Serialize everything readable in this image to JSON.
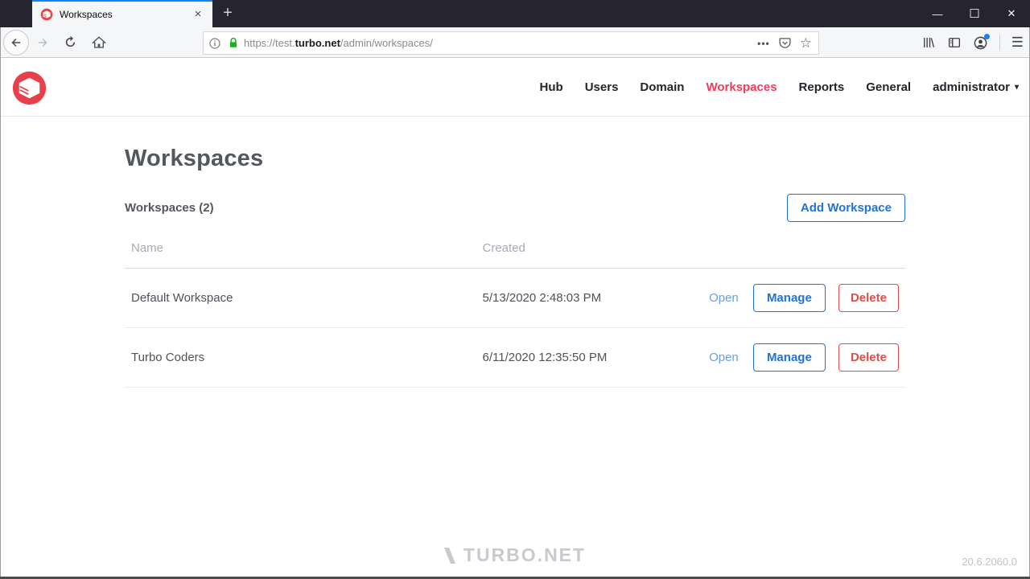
{
  "browser": {
    "tab": {
      "title": "Workspaces",
      "close_glyph": "×"
    },
    "new_tab_glyph": "+",
    "window_controls": {
      "minimize": "—",
      "maximize": "☐",
      "close": "✕"
    },
    "url": {
      "scheme_and_sub": "https://test.",
      "domain": "turbo.net",
      "path": "/admin/workspaces/"
    },
    "icons": {
      "page_actions_ellipsis": "•••",
      "bookmark_star": "☆",
      "menu_hamburger": "☰"
    }
  },
  "navbar": {
    "items": [
      {
        "label": "Hub",
        "active": false
      },
      {
        "label": "Users",
        "active": false
      },
      {
        "label": "Domain",
        "active": false
      },
      {
        "label": "Workspaces",
        "active": true
      },
      {
        "label": "Reports",
        "active": false
      },
      {
        "label": "General",
        "active": false
      }
    ],
    "user_menu": {
      "label": "administrator",
      "caret_glyph": "▾"
    }
  },
  "page": {
    "title": "Workspaces",
    "list_label": "Workspaces (2)",
    "add_button": "Add Workspace"
  },
  "table": {
    "columns": {
      "name": "Name",
      "created": "Created"
    },
    "rows": [
      {
        "name": "Default Workspace",
        "created": "5/13/2020 2:48:03 PM"
      },
      {
        "name": "Turbo Coders",
        "created": "6/11/2020 12:35:50 PM"
      }
    ],
    "actions": {
      "open": "Open",
      "manage": "Manage",
      "delete": "Delete"
    }
  },
  "footer": {
    "brand": "TURBO.NET",
    "version": "20.6.2060.0"
  },
  "colors": {
    "accent_blue": "#2272d8",
    "danger_red": "#dd4f47",
    "active_nav_pink": "#f8395c",
    "brand_red": "#e8404a",
    "lock_green": "#17b317",
    "titlebar_dark": "#26252f",
    "tab_active_stripe": "#0a84ff"
  }
}
